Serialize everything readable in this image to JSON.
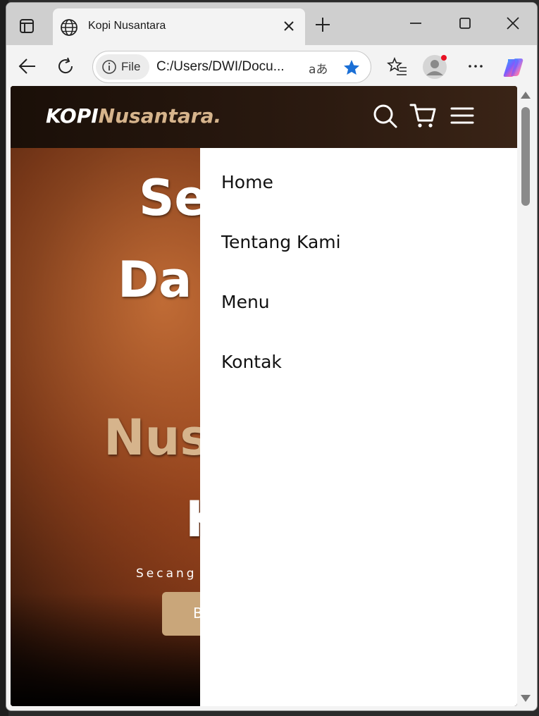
{
  "browser": {
    "tab_title": "Kopi Nusantara",
    "address": {
      "scheme_label": "File",
      "url": "C:/Users/DWI/Docu...",
      "translate_glyph": "aあ"
    }
  },
  "site": {
    "logo_primary": "KOPI",
    "logo_accent": "Nusantara.",
    "menu": [
      {
        "label": "Home"
      },
      {
        "label": "Tentang Kami"
      },
      {
        "label": "Menu"
      },
      {
        "label": "Kontak"
      }
    ],
    "hero": {
      "line1": "Se",
      "line2": "Da",
      "line3": "Nus",
      "line4": "K",
      "subtitle": "Secang",
      "button": "B"
    }
  },
  "colors": {
    "accent": "#d6b48c",
    "button": "#c9a67a",
    "star": "#1a6fd6",
    "notification": "#e81123"
  }
}
